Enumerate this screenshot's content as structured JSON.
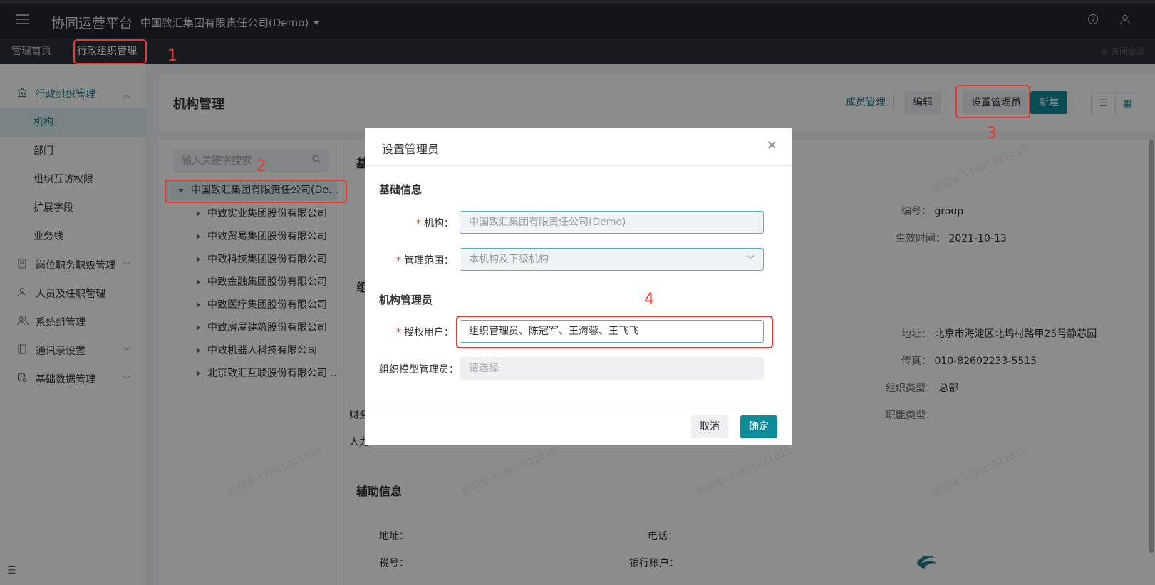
{
  "header": {
    "brand": "协同运营平台",
    "org_switch": "中国致汇集团有限责任公司(Demo)",
    "icons": [
      "info-icon",
      "user-icon"
    ]
  },
  "tabs": {
    "items": [
      "管理首页",
      "行政组织管理"
    ],
    "close_all": "关闭全部"
  },
  "sidebar": {
    "groups": [
      {
        "label": "行政组织管理",
        "icon": "bank-icon",
        "open": true
      },
      {
        "label": "岗位职务职级管理",
        "icon": "badge-icon"
      },
      {
        "label": "人员及任职管理",
        "icon": "person-icon"
      },
      {
        "label": "系统组管理",
        "icon": "people-icon"
      },
      {
        "label": "通讯录设置",
        "icon": "book-icon"
      },
      {
        "label": "基础数据管理",
        "icon": "database-icon"
      }
    ],
    "sub_items": [
      "机构",
      "部门",
      "组织互访权限",
      "扩展字段",
      "业务线"
    ]
  },
  "main": {
    "title": "机构管理",
    "actions": {
      "members": "成员管理",
      "edit": "编辑",
      "set_admin": "设置管理员",
      "new": "新建"
    }
  },
  "tree": {
    "search_placeholder": "输入关键字搜索",
    "root": "中国致汇集团有限责任公司(De...",
    "children": [
      "中致实业集团股份有限公司",
      "中致贸易集团股份有限公司",
      "中致科技集团股份有限公司",
      "中致金融集团股份有限公司",
      "中致医疗集团股份有限公司",
      "中致房屋建筑股份有限公司",
      "中致机器人科技有限公司",
      "北京致汇互联股份有限公司 ..."
    ]
  },
  "detail": {
    "base_initial": "基",
    "org_initial": "组",
    "code_label": "编号：",
    "code_value": "group",
    "effective_label": "生效时间：",
    "effective_value": "2021-10-13",
    "address_label": "地址：",
    "address_value": "北京市海淀区北坞村路甲25号静芯园",
    "fax_label": "传真：",
    "fax_value": "010-82602233-5515",
    "org_type_label": "组织类型：",
    "org_type_value": "总部",
    "func_type_label": "职能类型：",
    "finance_partial": "财务",
    "hr_partial": "人力",
    "aux_title": "辅助信息",
    "aux_address_label": "地址：",
    "aux_phone_label": "电话：",
    "aux_tax_label": "税号：",
    "aux_bank_label": "银行账户：",
    "watermark": "陈冠军 17601021816"
  },
  "modal": {
    "title": "设置管理员",
    "basic_section": "基础信息",
    "org_label": "机构：",
    "org_value": "中国致汇集团有限责任公司(Demo)",
    "scope_label": "管理范围：",
    "scope_value": "本机构及下级机构",
    "admin_section": "机构管理员",
    "users_label": "授权用户：",
    "users_value": "组织管理员、陈冠军、王海蓉、王飞飞",
    "model_admin_label": "组织模型管理员：",
    "model_admin_placeholder": "请选择",
    "cancel": "取消",
    "ok": "确定",
    "required_mark": "*"
  },
  "annotations": [
    "1",
    "2",
    "3",
    "4"
  ]
}
